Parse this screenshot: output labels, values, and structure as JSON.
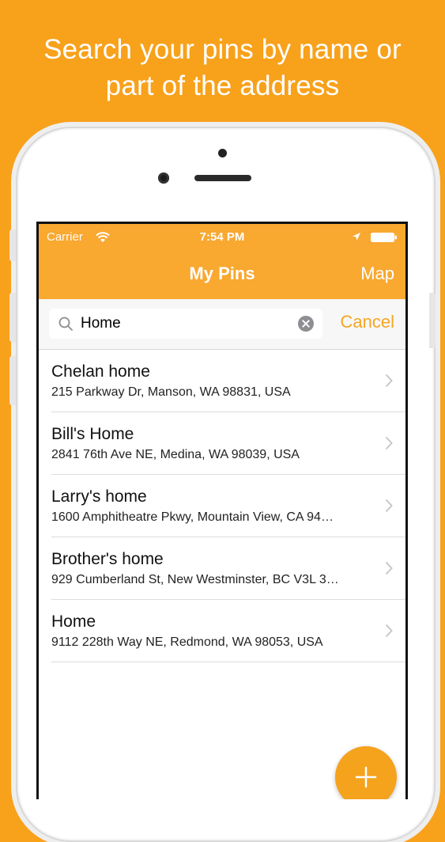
{
  "headline": {
    "line1": "Search your pins by name or",
    "line2": "part of the address"
  },
  "status_bar": {
    "carrier": "Carrier",
    "time": "7:54 PM"
  },
  "nav": {
    "title": "My Pins",
    "map_label": "Map"
  },
  "search": {
    "value": "Home",
    "cancel_label": "Cancel"
  },
  "pins": [
    {
      "name": "Chelan home",
      "address": "215 Parkway Dr, Manson, WA 98831, USA"
    },
    {
      "name": "Bill's Home",
      "address": "2841 76th Ave NE, Medina, WA 98039, USA"
    },
    {
      "name": "Larry's home",
      "address": "1600 Amphitheatre Pkwy, Mountain View, CA 94…"
    },
    {
      "name": "Brother's home",
      "address": "929 Cumberland St, New Westminster, BC V3L 3…"
    },
    {
      "name": "Home",
      "address": "9112 228th Way NE, Redmond, WA 98053, USA"
    }
  ],
  "icons": {
    "wifi": "wifi-icon",
    "location": "location-arrow-icon",
    "battery": "battery-icon",
    "search": "search-icon",
    "clear": "clear-icon",
    "chevron": "chevron-right-icon",
    "add": "plus-icon"
  },
  "colors": {
    "background": "#F8A11B",
    "nav": "#F9A830",
    "accent": "#F5A623"
  }
}
